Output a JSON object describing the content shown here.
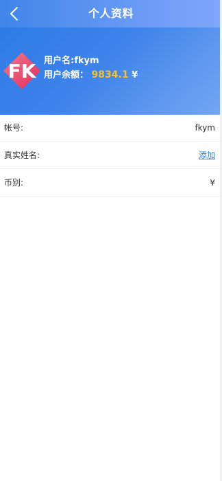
{
  "topbar": {
    "title": "个人资料",
    "back_icon": "chevron-left-icon"
  },
  "profile": {
    "avatar_icon": "fk-logo",
    "username_label": "用户名:",
    "username": "fkym",
    "balance_label": "用户余额：",
    "balance_value": "9834.1",
    "currency_symbol": "¥"
  },
  "list": {
    "items": [
      {
        "label": "帐号:",
        "value": "fkym"
      },
      {
        "label": "真实姓名:",
        "link": "添加"
      },
      {
        "label": "币别:",
        "value": "¥"
      }
    ]
  },
  "colors": {
    "topbar_start": "#3f86e9",
    "topbar_end": "#7fa8fb",
    "balance": "#f2c230",
    "link": "#2a7ce0"
  }
}
